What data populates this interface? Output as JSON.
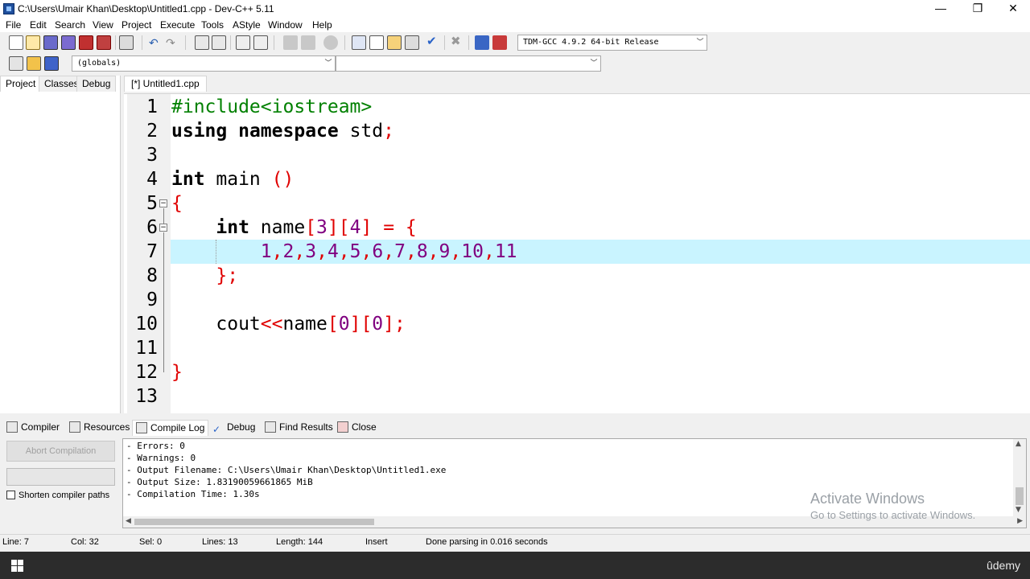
{
  "window": {
    "title": "C:\\Users\\Umair Khan\\Desktop\\Untitled1.cpp - Dev-C++ 5.11",
    "minimize": "—",
    "restore": "❐",
    "close": "✕"
  },
  "menu": [
    "File",
    "Edit",
    "Search",
    "View",
    "Project",
    "Execute",
    "Tools",
    "AStyle",
    "Window",
    "Help"
  ],
  "toolbar": {
    "compiler_select": "TDM-GCC 4.9.2 64-bit Release",
    "scope_select": "(globals)",
    "member_select": ""
  },
  "left_panel": {
    "tabs": [
      "Project",
      "Classes",
      "Debug"
    ],
    "active_tab": "Project"
  },
  "editor": {
    "tab_label": "[*] Untitled1.cpp",
    "line_numbers": [
      "1",
      "2",
      "3",
      "4",
      "5",
      "6",
      "7",
      "8",
      "9",
      "10",
      "11",
      "12",
      "13"
    ],
    "current_line": 7
  },
  "bottom_tabs": [
    "Compiler",
    "Resources",
    "Compile Log",
    "Debug",
    "Find Results",
    "Close"
  ],
  "bottom_active_tab": "Compile Log",
  "compile_panel": {
    "abort_button": "Abort Compilation",
    "shorten_paths_label": "Shorten compiler paths",
    "log_lines": [
      "- Errors: 0",
      "- Warnings: 0",
      "- Output Filename: C:\\Users\\Umair Khan\\Desktop\\Untitled1.exe",
      "- Output Size: 1.83190059661865 MiB",
      "- Compilation Time: 1.30s"
    ]
  },
  "watermark": {
    "line1": "Activate Windows",
    "line2": "Go to Settings to activate Windows."
  },
  "status": {
    "line": "Line:   7",
    "col": "Col:   32",
    "sel": "Sel:   0",
    "lines": "Lines:   13",
    "length": "Length:   144",
    "mode": "Insert",
    "message": "Done parsing in 0.016 seconds"
  },
  "taskbar": {
    "brand": "ûdemy"
  },
  "colors": {
    "current_line_bg": "#c9f4ff",
    "preprocessor": "#008000",
    "symbol": "#e00000",
    "number": "#800080"
  }
}
